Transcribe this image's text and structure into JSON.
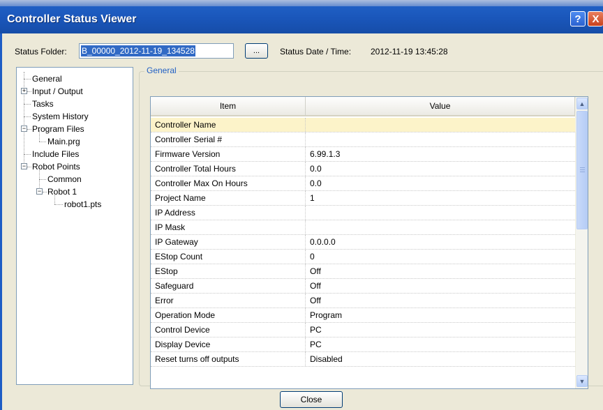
{
  "window": {
    "title": "Controller Status Viewer",
    "help_label": "?",
    "close_label": "X"
  },
  "status_folder": {
    "label": "Status Folder:",
    "value": "B_00000_2012-11-19_134528",
    "browse_label": "...",
    "date_label": "Status Date / Time:",
    "date_value": "2012-11-19 13:45:28"
  },
  "tree": {
    "items": [
      {
        "label": "General"
      },
      {
        "label": "Input / Output",
        "expander": "+"
      },
      {
        "label": "Tasks"
      },
      {
        "label": "System History"
      },
      {
        "label": "Program Files",
        "expander": "−"
      },
      {
        "label": "Main.prg"
      },
      {
        "label": "Include Files"
      },
      {
        "label": "Robot Points",
        "expander": "−"
      },
      {
        "label": "Common"
      },
      {
        "label": "Robot 1",
        "expander": "−"
      },
      {
        "label": "robot1.pts"
      }
    ]
  },
  "group": {
    "label": "General"
  },
  "grid": {
    "columns": [
      "Item",
      "Value"
    ],
    "rows": [
      [
        "Controller Name",
        ""
      ],
      [
        "Controller Serial #",
        ""
      ],
      [
        "Firmware Version",
        "6.99.1.3"
      ],
      [
        "Controller Total Hours",
        "0.0"
      ],
      [
        "Controller Max On Hours",
        "0.0"
      ],
      [
        "Project Name",
        "1"
      ],
      [
        "IP Address",
        ""
      ],
      [
        "IP Mask",
        ""
      ],
      [
        "IP Gateway",
        "0.0.0.0"
      ],
      [
        "EStop Count",
        "0"
      ],
      [
        "EStop",
        "Off"
      ],
      [
        "Safeguard",
        "Off"
      ],
      [
        "Error",
        "Off"
      ],
      [
        "Operation Mode",
        "Program"
      ],
      [
        "Control Device",
        "PC"
      ],
      [
        "Display Device",
        "PC"
      ],
      [
        "Reset turns off outputs",
        "Disabled"
      ]
    ]
  },
  "footer": {
    "close_label": "Close"
  }
}
